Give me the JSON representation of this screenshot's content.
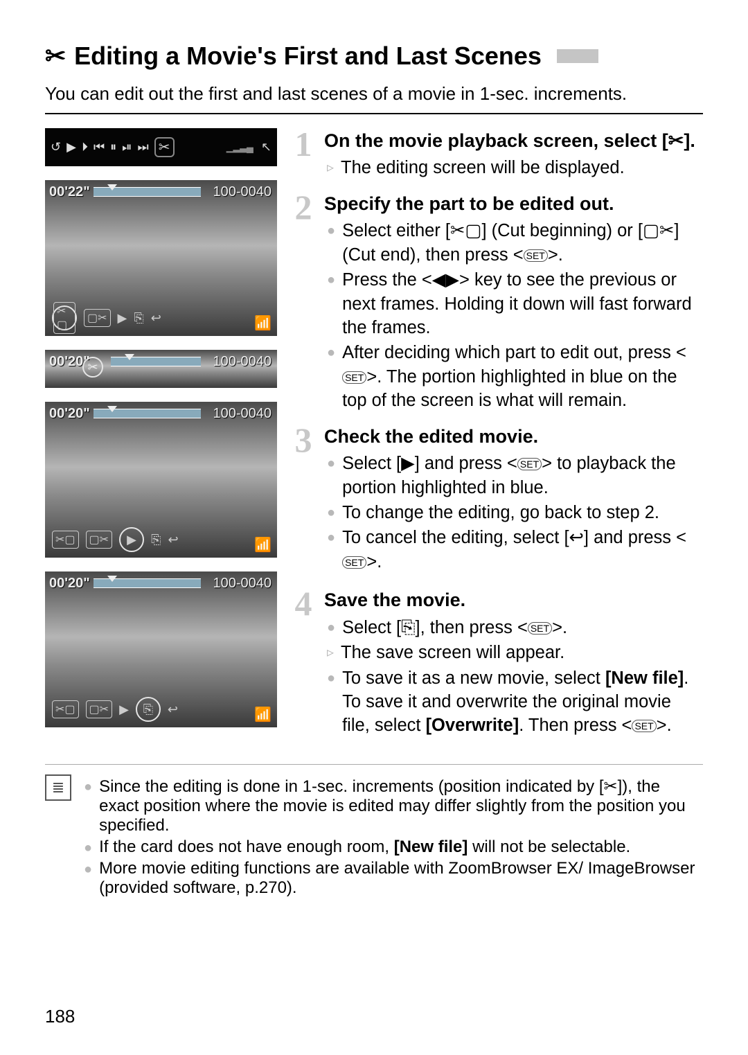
{
  "title_icon": "✂",
  "title": "Editing a Movie's First and Last Scenes",
  "intro": "You can edit out the first and last scenes of a movie in 1-sec. increments.",
  "playback": {
    "icons": [
      "↺",
      "▶",
      "⏵",
      "⏮",
      "⏸",
      "⏯",
      "⏭"
    ],
    "selected": "✂",
    "bars": "▁▂▃▄",
    "ret": "↖"
  },
  "thumbs": {
    "a": {
      "time": "00'22\"",
      "file": "100-0040"
    },
    "b": {
      "time": "00'20\"",
      "file": "100-0040",
      "mark": "✂"
    },
    "c": {
      "time": "00'20\"",
      "file": "100-0040"
    },
    "d": {
      "time": "00'20\"",
      "file": "100-0040"
    }
  },
  "tool_icons": {
    "cut_begin": "✂▢",
    "cut_end": "▢✂",
    "play": "▶",
    "save": "⎘",
    "undo": "↩"
  },
  "steps": [
    {
      "num": "1",
      "title_a": "On the movie playback screen, select [",
      "title_icon": "✂",
      "title_b": "].",
      "bullets": [
        {
          "mark": "▹",
          "text": "The editing screen will be displayed."
        }
      ]
    },
    {
      "num": "2",
      "title": "Specify the part to be edited out.",
      "bullets": [
        {
          "mark": "●",
          "pre": "Select either [",
          "icon1": "✂▢",
          "mid1": "] (Cut beginning) or [",
          "icon2": "▢✂",
          "mid2": "] (Cut end), then press <",
          "set": "SET",
          "post": ">."
        },
        {
          "mark": "●",
          "pre2": "Press the <◀▶> key to see the previous or next frames. Holding it down will fast forward the frames."
        },
        {
          "mark": "●",
          "pre": "After deciding which part to edit out, press <",
          "set": "SET",
          "post": ">. The portion highlighted in blue on the top of the screen is what will remain."
        }
      ]
    },
    {
      "num": "3",
      "title": "Check the edited movie.",
      "bullets": [
        {
          "mark": "●",
          "pre": "Select [▶] and press <",
          "set": "SET",
          "post": "> to playback the portion highlighted in blue."
        },
        {
          "mark": "●",
          "pre2": "To change the editing, go back to step 2."
        },
        {
          "mark": "●",
          "pre": "To cancel the editing, select [↩] and press <",
          "set": "SET",
          "post": ">."
        }
      ]
    },
    {
      "num": "4",
      "title": "Save the movie.",
      "bullets": [
        {
          "mark": "●",
          "pre": "Select [⎘], then press <",
          "set": "SET",
          "post": ">."
        },
        {
          "mark": "▹",
          "pre2": "The save screen will appear."
        },
        {
          "mark": "●",
          "compound": true,
          "t1": "To save it as a new movie, select ",
          "b1": "[New file]",
          "t2": ". To save it and overwrite the original movie file, select ",
          "b2": "[Overwrite]",
          "t3": ". Then press <",
          "set": "SET",
          "t4": ">."
        }
      ]
    }
  ],
  "notes": [
    {
      "pre": "Since the editing is done in 1-sec. increments (position indicated by [",
      "icon": "✂",
      "post": "]), the exact position where the movie is edited may differ slightly from the position you specified."
    },
    {
      "compound": true,
      "t1": "If the card does not have enough room, ",
      "b1": "[New file]",
      "t2": " will not be selectable."
    },
    {
      "text": "More movie editing functions are available with ZoomBrowser EX/ ImageBrowser (provided software, p.270)."
    }
  ],
  "page_number": "188"
}
